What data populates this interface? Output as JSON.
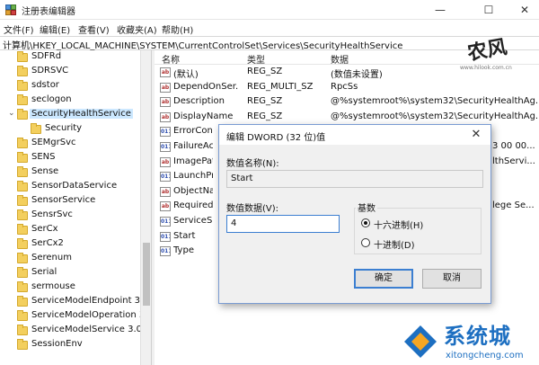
{
  "window": {
    "title": "注册表编辑器",
    "minimize_glyph": "—",
    "maximize_glyph": "☐",
    "close_glyph": "✕"
  },
  "menu": [
    "文件(F)",
    "编辑(E)",
    "查看(V)",
    "收藏夹(A)",
    "帮助(H)"
  ],
  "address": "计算机\\HKEY_LOCAL_MACHINE\\SYSTEM\\CurrentControlSet\\Services\\SecurityHealthService",
  "tree": {
    "items": [
      {
        "label": "SDFRd"
      },
      {
        "label": "SDRSVC"
      },
      {
        "label": "sdstor"
      },
      {
        "label": "seclogon"
      },
      {
        "label": "SecurityHealthService",
        "selected": true,
        "expanded": true
      },
      {
        "label": "Security",
        "child": true
      },
      {
        "label": "SEMgrSvc"
      },
      {
        "label": "SENS"
      },
      {
        "label": "Sense"
      },
      {
        "label": "SensorDataService"
      },
      {
        "label": "SensorService"
      },
      {
        "label": "SensrSvc"
      },
      {
        "label": "SerCx"
      },
      {
        "label": "SerCx2"
      },
      {
        "label": "Serenum"
      },
      {
        "label": "Serial"
      },
      {
        "label": "sermouse"
      },
      {
        "label": "ServiceModelEndpoint 3.0"
      },
      {
        "label": "ServiceModelOperation 3."
      },
      {
        "label": "ServiceModelService 3.0.0"
      },
      {
        "label": "SessionEnv"
      }
    ]
  },
  "list": {
    "headers": {
      "name": "名称",
      "type": "类型",
      "data": "数据"
    },
    "rows": [
      {
        "name": "(默认)",
        "type": "REG_SZ",
        "data": "(数值未设置)",
        "icon": "string-value-icon"
      },
      {
        "name": "DependOnSer...",
        "type": "REG_MULTI_SZ",
        "data": "RpcSs",
        "icon": "string-value-icon"
      },
      {
        "name": "Description",
        "type": "REG_SZ",
        "data": "@%systemroot%\\system32\\SecurityHealthAg...",
        "icon": "string-value-icon"
      },
      {
        "name": "DisplayName",
        "type": "REG_SZ",
        "data": "@%systemroot%\\system32\\SecurityHealthAg...",
        "icon": "string-value-icon"
      },
      {
        "name": "ErrorContr",
        "type": "",
        "data": "",
        "icon": "binary-value-icon"
      },
      {
        "name": "FailureActio",
        "type": "",
        "data": "3 00 00...",
        "icon": "binary-value-icon"
      },
      {
        "name": "ImagePath",
        "type": "",
        "data": "lthServi...",
        "icon": "string-value-icon"
      },
      {
        "name": "LaunchProt",
        "type": "",
        "data": "",
        "icon": "binary-value-icon"
      },
      {
        "name": "ObjectNam",
        "type": "",
        "data": "",
        "icon": "string-value-icon"
      },
      {
        "name": "RequiredPr",
        "type": "",
        "data": "lege Se...",
        "icon": "string-value-icon"
      },
      {
        "name": "ServiceSidT",
        "type": "",
        "data": "",
        "icon": "binary-value-icon"
      },
      {
        "name": "Start",
        "type": "",
        "data": "",
        "icon": "binary-value-icon"
      },
      {
        "name": "Type",
        "type": "",
        "data": "",
        "icon": "binary-value-icon"
      }
    ]
  },
  "dialog": {
    "title": "编辑 DWORD (32 位)值",
    "close_glyph": "✕",
    "name_label": "数值名称(N):",
    "name_value": "Start",
    "data_label": "数值数据(V):",
    "data_value": "4",
    "base_label": "基数",
    "radio_hex": "十六进制(H)",
    "radio_dec": "十进制(D)",
    "radio_hex_checked": true,
    "ok": "确定",
    "cancel": "取消"
  },
  "watermark": {
    "logo_text": "农风",
    "logo_url": "www.hilook.com.cn",
    "brand": "系统城",
    "brand_url": "xitongcheng.com"
  }
}
